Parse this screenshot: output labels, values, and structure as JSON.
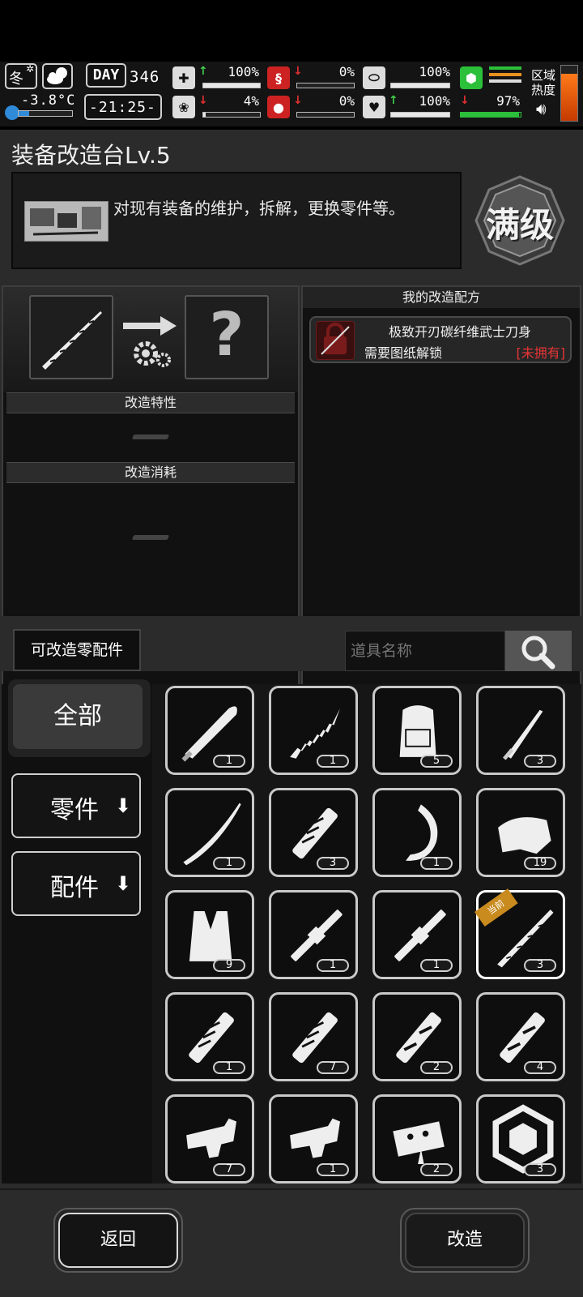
{
  "status_bar": {
    "season": "冬",
    "weather_icon": "cloud-moon-icon",
    "temperature": "-3.8°C",
    "day_label": "DAY",
    "day_number": "346",
    "time": "-21:25-",
    "stats": [
      {
        "icon": "medkit-icon",
        "trend": "up",
        "value": "100%",
        "fill": 1.0
      },
      {
        "icon": "stomach-icon",
        "trend": "down",
        "value": "0%",
        "fill": 0.0
      },
      {
        "icon": "capsule-icon",
        "trend": "none",
        "value": "100%",
        "fill": 1.0
      },
      {
        "icon": "brain-icon",
        "trend": "down",
        "value": "4%",
        "fill": 0.04
      },
      {
        "icon": "blood-drop-icon",
        "trend": "down",
        "value": "0%",
        "fill": 0.0
      },
      {
        "icon": "heart-icon",
        "trend": "up",
        "value": "100%",
        "fill": 1.0
      },
      {
        "icon": "boot-icon",
        "trend": "down",
        "value": "97%",
        "fill": 0.97
      }
    ],
    "zone_heat_label": "区域热度",
    "sound_icon": "speaker-icon"
  },
  "header": {
    "title": "装备改造台Lv.5",
    "description": "对现有装备的维护，拆解，更换零件等。",
    "max_level_label": "满级"
  },
  "modify": {
    "unknown_result": "?",
    "traits_header": "改造特性",
    "cost_header": "改造消耗"
  },
  "recipes": {
    "header": "我的改造配方",
    "items": [
      {
        "name": "极致开刃碳纤维武士刀身",
        "requirement": "需要图纸解锁",
        "status": "[未拥有]"
      }
    ]
  },
  "filter": {
    "button_label": "可改造零配件",
    "search_placeholder": "道具名称"
  },
  "categories": [
    {
      "label": "全部",
      "active": true
    },
    {
      "label": "零件",
      "active": false
    },
    {
      "label": "配件",
      "active": false
    }
  ],
  "current_badge": "当前",
  "items": [
    {
      "icon": "machete-icon",
      "count": "1"
    },
    {
      "icon": "jagged-blade-icon",
      "count": "1"
    },
    {
      "icon": "backpack-icon",
      "count": "5"
    },
    {
      "icon": "dagger-icon",
      "count": "3"
    },
    {
      "icon": "katana-blade-icon",
      "count": "1"
    },
    {
      "icon": "wrapped-handle-icon",
      "count": "3"
    },
    {
      "icon": "hand-guard-icon",
      "count": "1"
    },
    {
      "icon": "cloth-scraps-icon",
      "count": "19"
    },
    {
      "icon": "vest-icon",
      "count": "9"
    },
    {
      "icon": "barrel-icon",
      "count": "1"
    },
    {
      "icon": "barrel-icon",
      "count": "1"
    },
    {
      "icon": "serrated-katana-icon",
      "count": "3",
      "current": true
    },
    {
      "icon": "wrapped-handle-icon",
      "count": "1"
    },
    {
      "icon": "wrapped-handle-icon",
      "count": "7"
    },
    {
      "icon": "taped-grip-icon",
      "count": "2"
    },
    {
      "icon": "taped-grip-icon",
      "count": "4"
    },
    {
      "icon": "trigger-assembly-icon",
      "count": "7"
    },
    {
      "icon": "trigger-assembly-icon",
      "count": "1"
    },
    {
      "icon": "trigger-group-icon",
      "count": "2"
    },
    {
      "icon": "weight-plate-icon",
      "count": "3"
    }
  ],
  "footer": {
    "back_label": "返回",
    "modify_label": "改造"
  }
}
